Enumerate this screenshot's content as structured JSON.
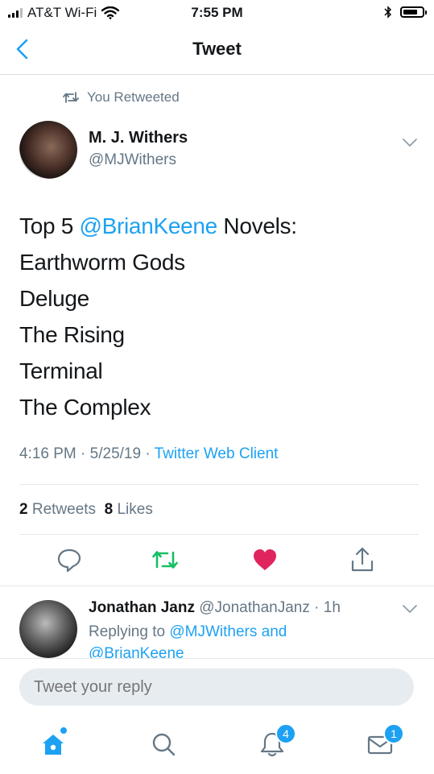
{
  "status_bar": {
    "carrier": "AT&T Wi-Fi",
    "time": "7:55 PM"
  },
  "nav": {
    "title": "Tweet"
  },
  "retweet": {
    "label": "You Retweeted"
  },
  "tweet": {
    "author_name": "M. J. Withers",
    "author_handle": "@MJWithers",
    "line1_prefix": "Top 5 ",
    "line1_mention": "@BrianKeene",
    "line1_suffix": " Novels:",
    "lines": [
      "Earthworm Gods",
      "Deluge",
      "The Rising",
      "Terminal",
      "The Complex"
    ],
    "time": "4:16 PM",
    "date": "5/25/19",
    "sep": " · ",
    "source": "Twitter Web Client",
    "retweets_count": "2",
    "retweets_label": "Retweets",
    "likes_count": "8",
    "likes_label": "Likes"
  },
  "reply": {
    "author_name": "Jonathan Janz",
    "author_handle": "@JonathanJanz",
    "age": "1h",
    "replying_prefix": "Replying to ",
    "replying_mention1": "@MJWithers",
    "replying_and": " and",
    "replying_mention2": "@BrianKeene"
  },
  "composer": {
    "placeholder": "Tweet your reply"
  },
  "tabbar": {
    "notifications_badge": "4",
    "messages_badge": "1"
  },
  "colors": {
    "accent": "#1da1f2",
    "retweet_green": "#17bf63",
    "like_red": "#e0245e",
    "muted": "#657786"
  },
  "icons": [
    "back-icon",
    "retweet-small-icon",
    "chevron-down-icon",
    "reply-icon",
    "retweet-icon",
    "like-icon",
    "share-icon",
    "home-icon",
    "search-icon",
    "notifications-icon",
    "messages-icon"
  ]
}
